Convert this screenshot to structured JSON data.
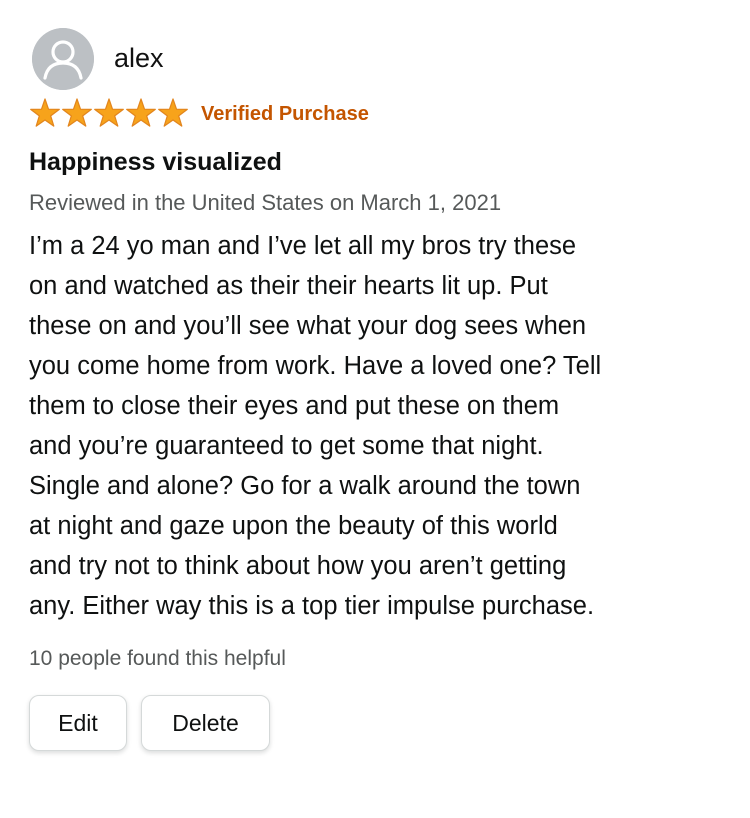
{
  "review": {
    "author": {
      "name": "alex",
      "avatar_icon": "user-silhouette-icon"
    },
    "rating": {
      "stars": 5,
      "max_stars": 5,
      "star_color": "#f7a31b",
      "star_icon": "star-icon"
    },
    "badge": {
      "label": "Verified Purchase",
      "color": "#c45500"
    },
    "title": "Happiness visualized",
    "meta": "Reviewed in the United States on March 1, 2021",
    "body_lines": [
      "I’m a 24 yo man and I’ve let all my bros try these",
      "on and watched as their their hearts lit up. Put",
      "these on and you’ll see what your dog sees when",
      "you come home from work. Have a loved one? Tell",
      "them to close their eyes and put these on them",
      "and you’re guaranteed to get some that night.",
      "Single and alone? Go for a walk around the town",
      "at night and gaze upon the beauty of this world",
      "and try not to think about how you aren’t getting",
      "any. Either way this is a top tier impulse purchase."
    ],
    "helpful": "10 people found this helpful",
    "actions": {
      "edit_label": "Edit",
      "delete_label": "Delete"
    }
  }
}
